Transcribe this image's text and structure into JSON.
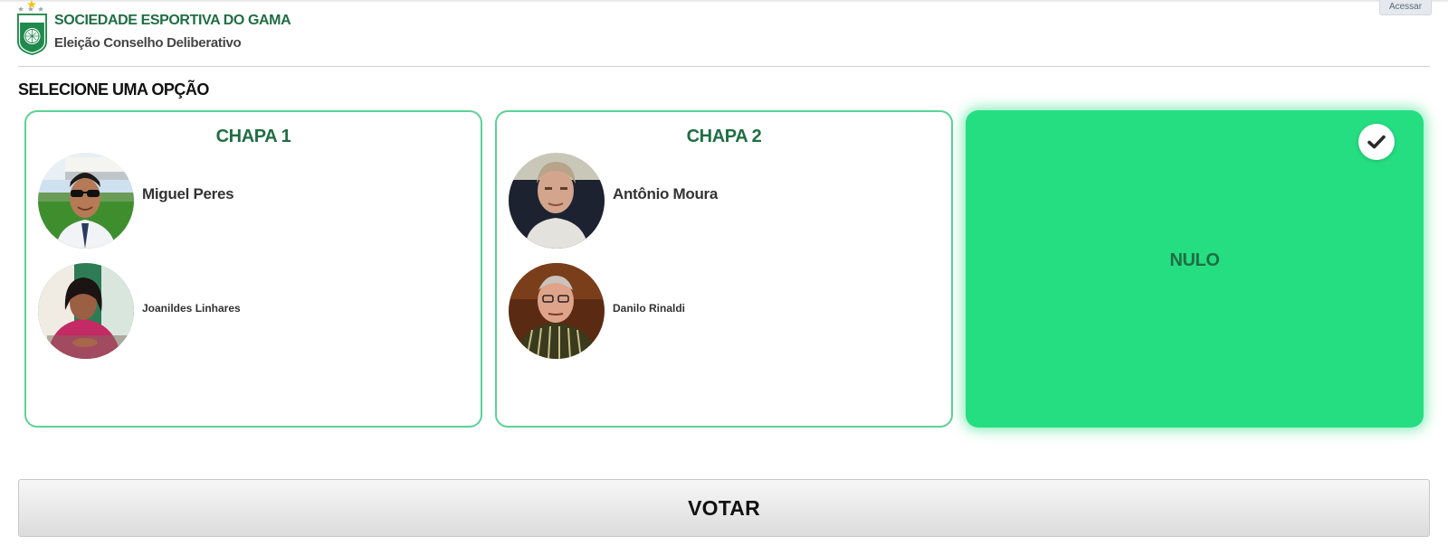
{
  "header": {
    "org_name": "SOCIEDADE ESPORTIVA DO GAMA",
    "subtitle": "Eleição Conselho Deliberativo",
    "login_label": "Acessar",
    "logo_text": "GAMA"
  },
  "section_title": "SELECIONE UMA OPÇÃO",
  "options": [
    {
      "title": "CHAPA 1",
      "main_candidate": "Miguel Peres",
      "vice_candidate": "Joanildes Linhares",
      "selected": false
    },
    {
      "title": "CHAPA 2",
      "main_candidate": "Antônio Moura",
      "vice_candidate": "Danilo Rinaldi",
      "selected": false
    },
    {
      "title": "NULO",
      "selected": true
    }
  ],
  "vote_button": "VOTAR",
  "colors": {
    "brand_green": "#1f6e43",
    "card_border": "#5cd294",
    "selected_bg": "#25de82"
  }
}
